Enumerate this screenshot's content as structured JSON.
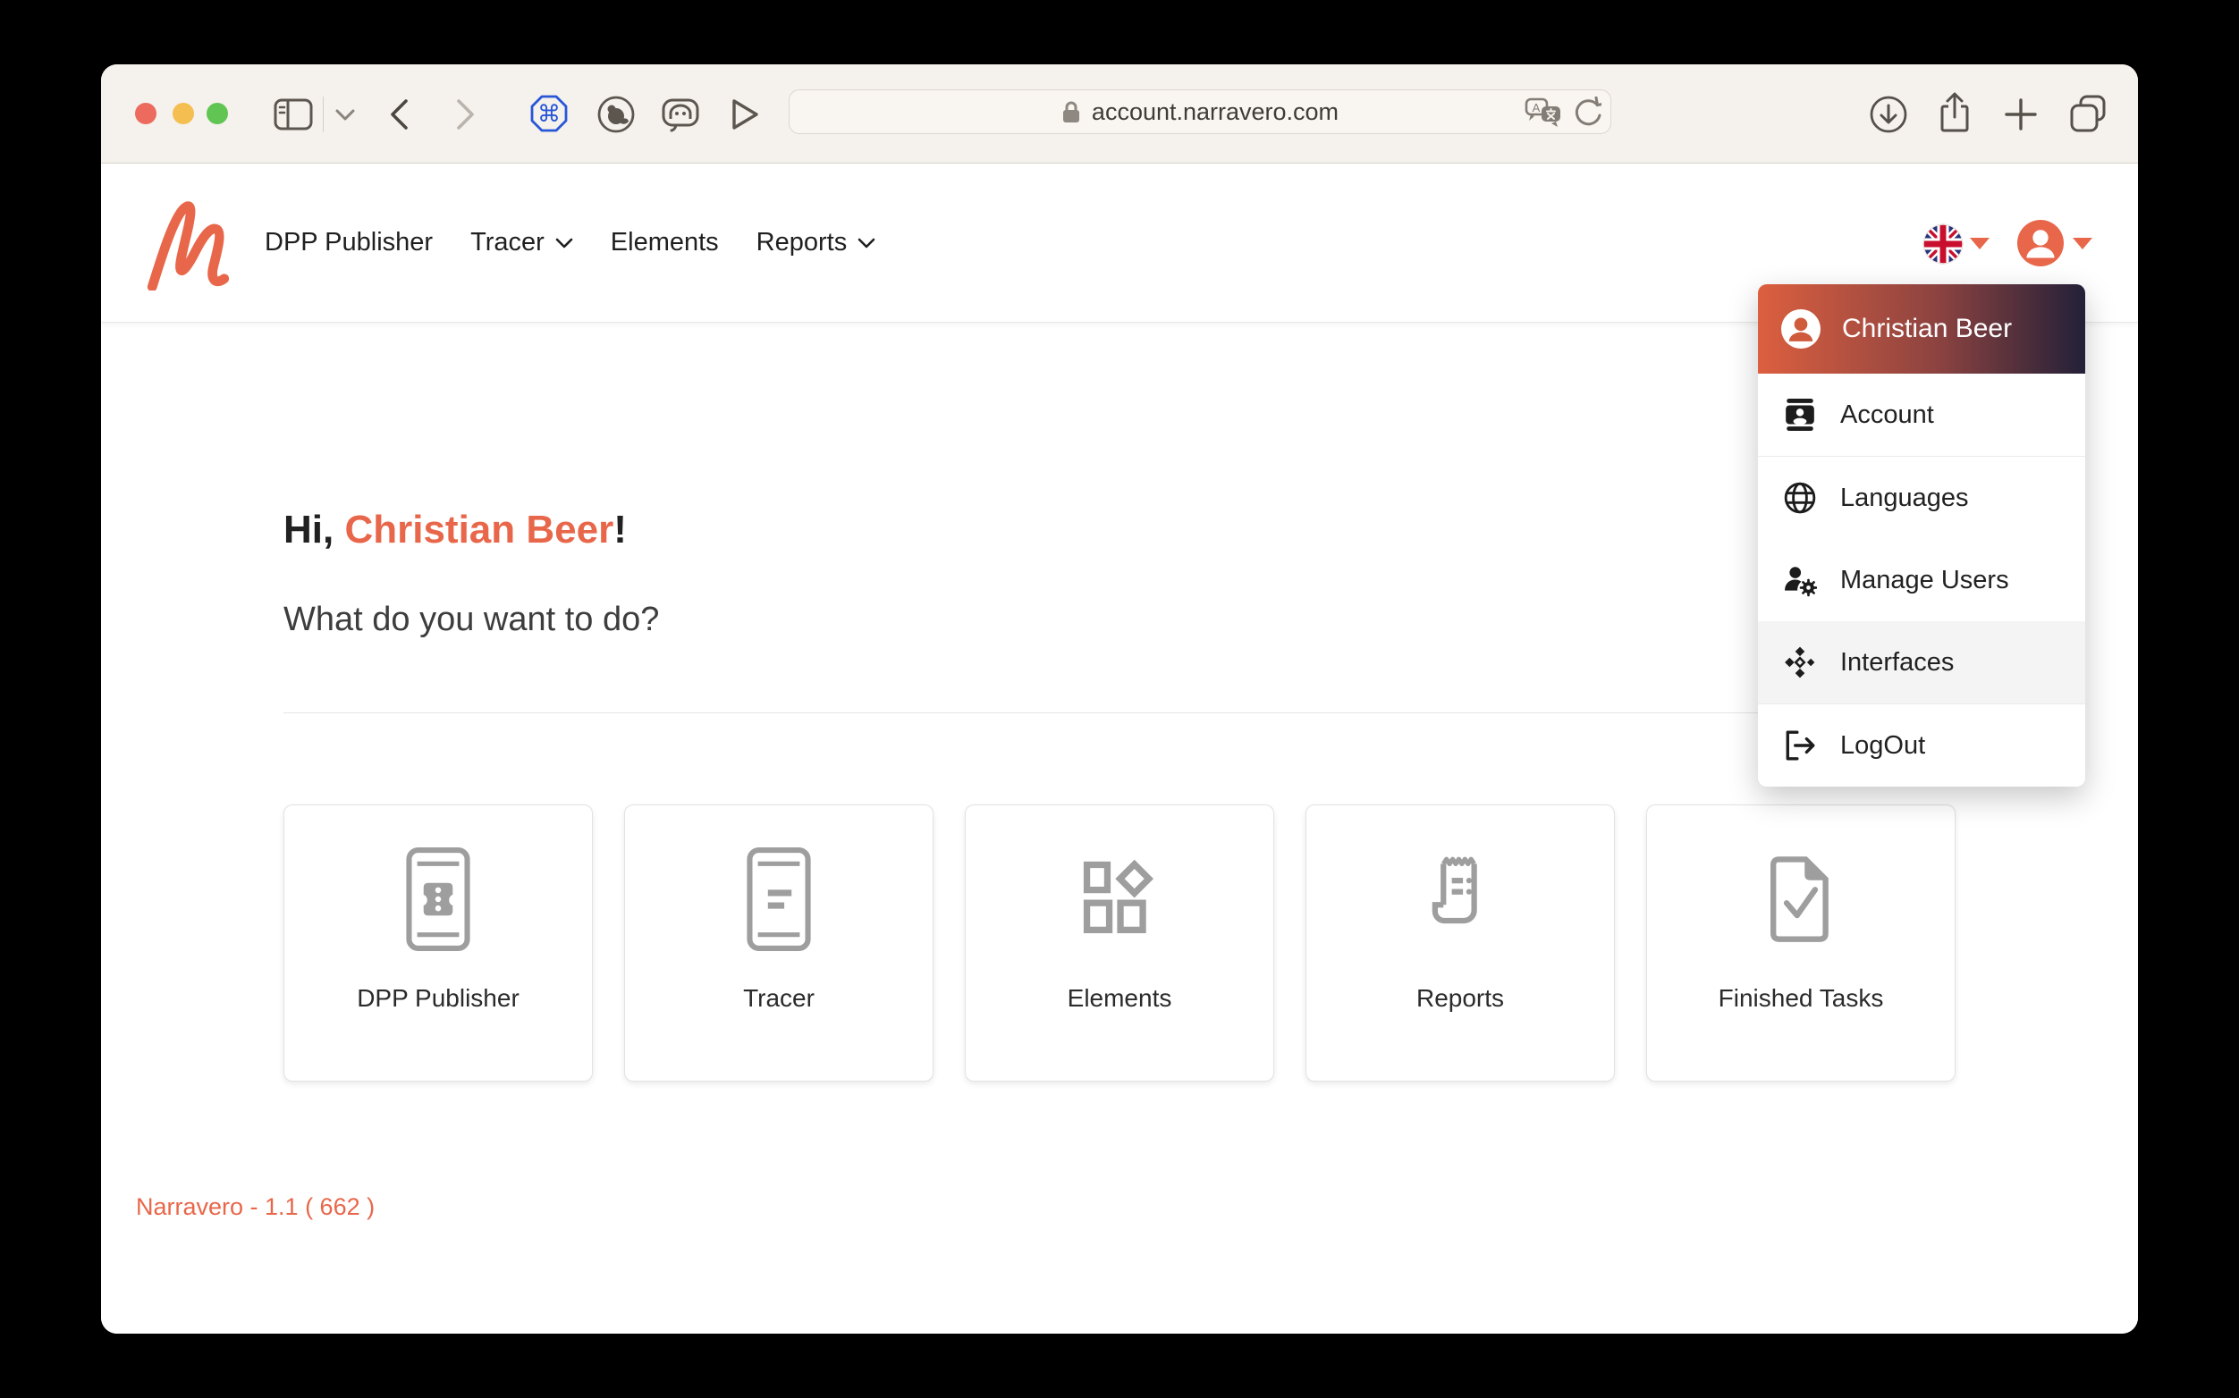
{
  "browser": {
    "url": "account.narravero.com",
    "toolbar_icons": [
      "sidebar-toggle-icon",
      "chevron-down-icon",
      "back-icon",
      "forward-icon",
      "command-extension-icon",
      "bear-extension-icon",
      "elephant-extension-icon",
      "play-extension-icon",
      "lock-icon",
      "translate-icon",
      "reload-icon",
      "download-icon",
      "share-icon",
      "new-tab-icon",
      "tab-overview-icon"
    ],
    "traffic_lights": [
      "close",
      "minimize",
      "zoom"
    ]
  },
  "header": {
    "logo_name": "narravero-logo",
    "nav": {
      "items": [
        {
          "label": "DPP Publisher",
          "has_dropdown": false
        },
        {
          "label": "Tracer",
          "has_dropdown": true
        },
        {
          "label": "Elements",
          "has_dropdown": false
        },
        {
          "label": "Reports",
          "has_dropdown": true
        }
      ]
    },
    "language_flag": "uk-flag-icon",
    "avatar": "user-avatar-icon"
  },
  "user_menu": {
    "name": "Christian Beer",
    "items": [
      {
        "label": "Account",
        "icon": "contact-card-icon",
        "highlighted": false
      },
      {
        "label": "Languages",
        "icon": "globe-icon",
        "highlighted": false
      },
      {
        "label": "Manage Users",
        "icon": "user-gear-icon",
        "highlighted": false
      },
      {
        "label": "Interfaces",
        "icon": "hub-diamonds-icon",
        "highlighted": true
      },
      {
        "label": "LogOut",
        "icon": "logout-icon",
        "highlighted": false
      }
    ]
  },
  "main": {
    "greeting_prefix": "Hi, ",
    "greeting_name": "Christian Beer",
    "greeting_suffix": "!",
    "question": "What do you want to do?",
    "cards": [
      {
        "label": "DPP Publisher",
        "icon": "phone-label-icon"
      },
      {
        "label": "Tracer",
        "icon": "phone-lines-icon"
      },
      {
        "label": "Elements",
        "icon": "shapes-icon"
      },
      {
        "label": "Reports",
        "icon": "receipt-icon"
      },
      {
        "label": "Finished Tasks",
        "icon": "document-check-icon"
      }
    ]
  },
  "footer": {
    "version_text": "Narravero - 1.1 ( 662 )"
  },
  "colors": {
    "accent": "#e8674a",
    "menu_gradient_start": "#dc5f3f",
    "menu_gradient_end": "#232038",
    "toolbar_bg": "#f5f1ec",
    "card_icon_gray": "#9e9e9e"
  }
}
